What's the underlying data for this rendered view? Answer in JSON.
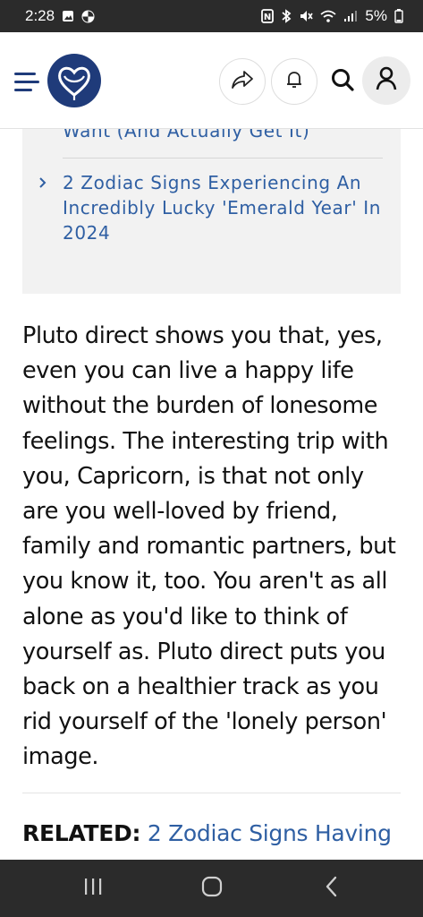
{
  "status_bar": {
    "time": "2:28",
    "battery": "5%",
    "icons": [
      "gallery-icon",
      "pinwheel-icon",
      "nfc-icon",
      "bluetooth-icon",
      "mute-icon",
      "wifi-icon",
      "signal-icon",
      "battery-icon"
    ]
  },
  "header": {
    "menu_icon": "hamburger-icon",
    "logo_icon": "heart-logo-icon",
    "share_icon": "share-icon",
    "bell_icon": "bell-icon",
    "search_icon": "search-icon",
    "user_icon": "user-icon",
    "accent_color": "#1f3b7a"
  },
  "related_box": {
    "items": [
      {
        "text": "Exactly How To Manifest What You Want (And Actually Get It)",
        "visible_text": "You Want (And Actually Get It)"
      },
      {
        "text": "2 Zodiac Signs Experiencing An Incredibly Lucky 'Emerald Year' In 2024"
      }
    ],
    "link_color": "#2f5fa3"
  },
  "article": {
    "paragraph": "Pluto direct shows you that, yes, even you can live a happy life without the burden of lonesome feelings. The interesting trip with you, Capricorn, is that not only are you well-loved by friend, family and romantic partners, but you know it, too. You aren't as all alone as you'd like to think of yourself as. Pluto direct puts you back on a healthier track as you rid yourself of the 'lonely person' image.",
    "related_label": "RELATED:",
    "related_link": "2 Zodiac Signs Having"
  },
  "nav_bar": {
    "recents_icon": "recents-icon",
    "home_icon": "home-icon",
    "back_icon": "back-icon"
  }
}
